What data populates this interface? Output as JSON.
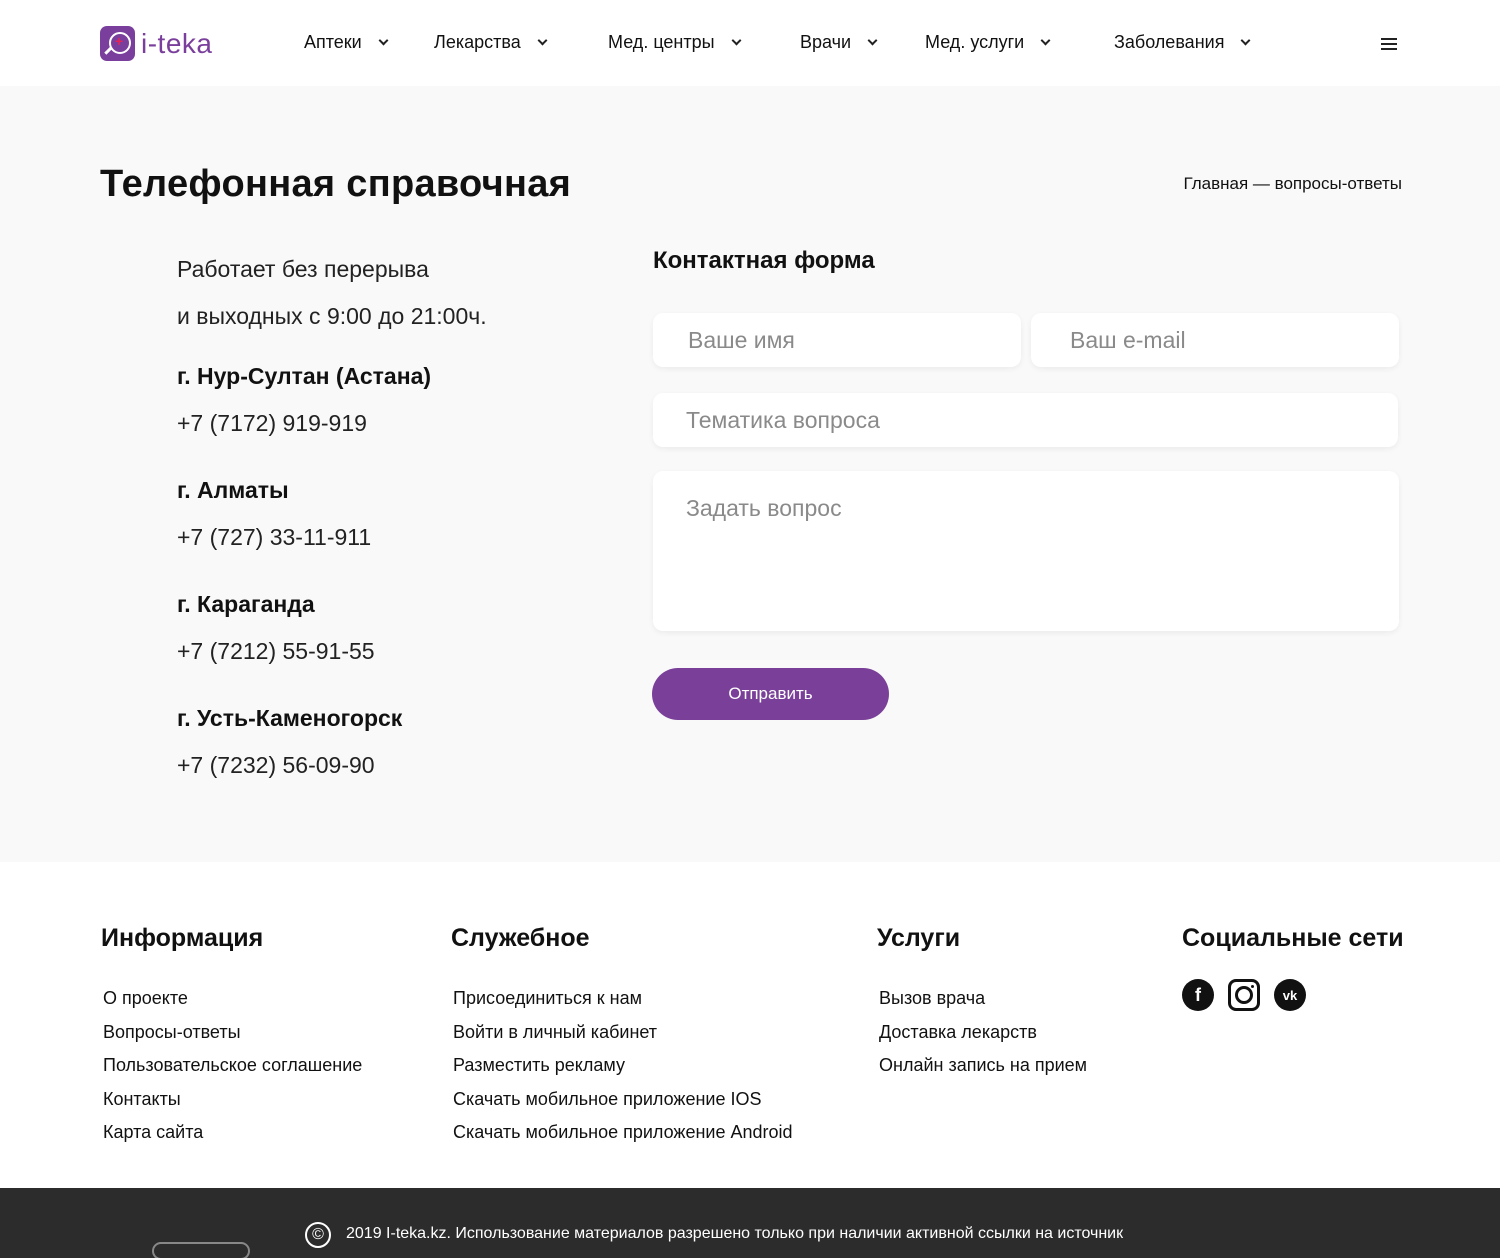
{
  "header": {
    "logo_text": "i-teka",
    "nav": [
      {
        "label": "Аптеки"
      },
      {
        "label": "Лекарства"
      },
      {
        "label": "Мед. центры"
      },
      {
        "label": "Врачи"
      },
      {
        "label": "Мед. услуги"
      },
      {
        "label": "Заболевания"
      }
    ]
  },
  "main": {
    "title": "Телефонная справочная",
    "breadcrumb": "Главная — вопросы-ответы",
    "hours_line1": "Работает без перерыва",
    "hours_line2": "и выходных с 9:00 до 21:00ч.",
    "contacts": [
      {
        "city": "г. Нур-Султан (Астана)",
        "phone": "+7 (7172) 919-919"
      },
      {
        "city": "г. Алматы",
        "phone": "+7 (727) 33-11-911"
      },
      {
        "city": "г. Караганда",
        "phone": "+7 (7212) 55-91-55"
      },
      {
        "city": "г. Усть-Каменогорск",
        "phone": "+7 (7232) 56-09-90"
      }
    ],
    "form": {
      "title": "Контактная форма",
      "name_placeholder": "Ваше имя",
      "email_placeholder": "Ваш e-mail",
      "topic_placeholder": "Тематика вопроса",
      "question_placeholder": "Задать вопрос",
      "submit_label": "Отправить"
    }
  },
  "footer": {
    "columns": [
      {
        "title": "Информация",
        "links": [
          "О проекте",
          "Вопросы-ответы",
          "Пользовательское соглашение",
          "Контакты",
          "Карта сайта"
        ]
      },
      {
        "title": "Служебное",
        "links": [
          "Присоединиться к нам",
          "Войти в личный кабинет",
          "Разместить рекламу",
          "Скачать мобильное приложение IOS",
          "Скачать мобильное приложение Android"
        ]
      },
      {
        "title": "Услуги",
        "links": [
          "Вызов врача",
          "Доставка лекарств",
          "Онлайн запись на прием"
        ]
      },
      {
        "title": "Социальные сети"
      }
    ],
    "social_icons": [
      "facebook-icon",
      "instagram-icon",
      "vk-icon"
    ],
    "copyright_symbol": "©",
    "copyright": "2019 I-teka.kz. Использование материалов разрешено только при наличии активной ссылки на источник"
  },
  "colors": {
    "brand": "#7a3f9c",
    "button": "#7a4099",
    "footer_bar": "#2c2c2c"
  }
}
